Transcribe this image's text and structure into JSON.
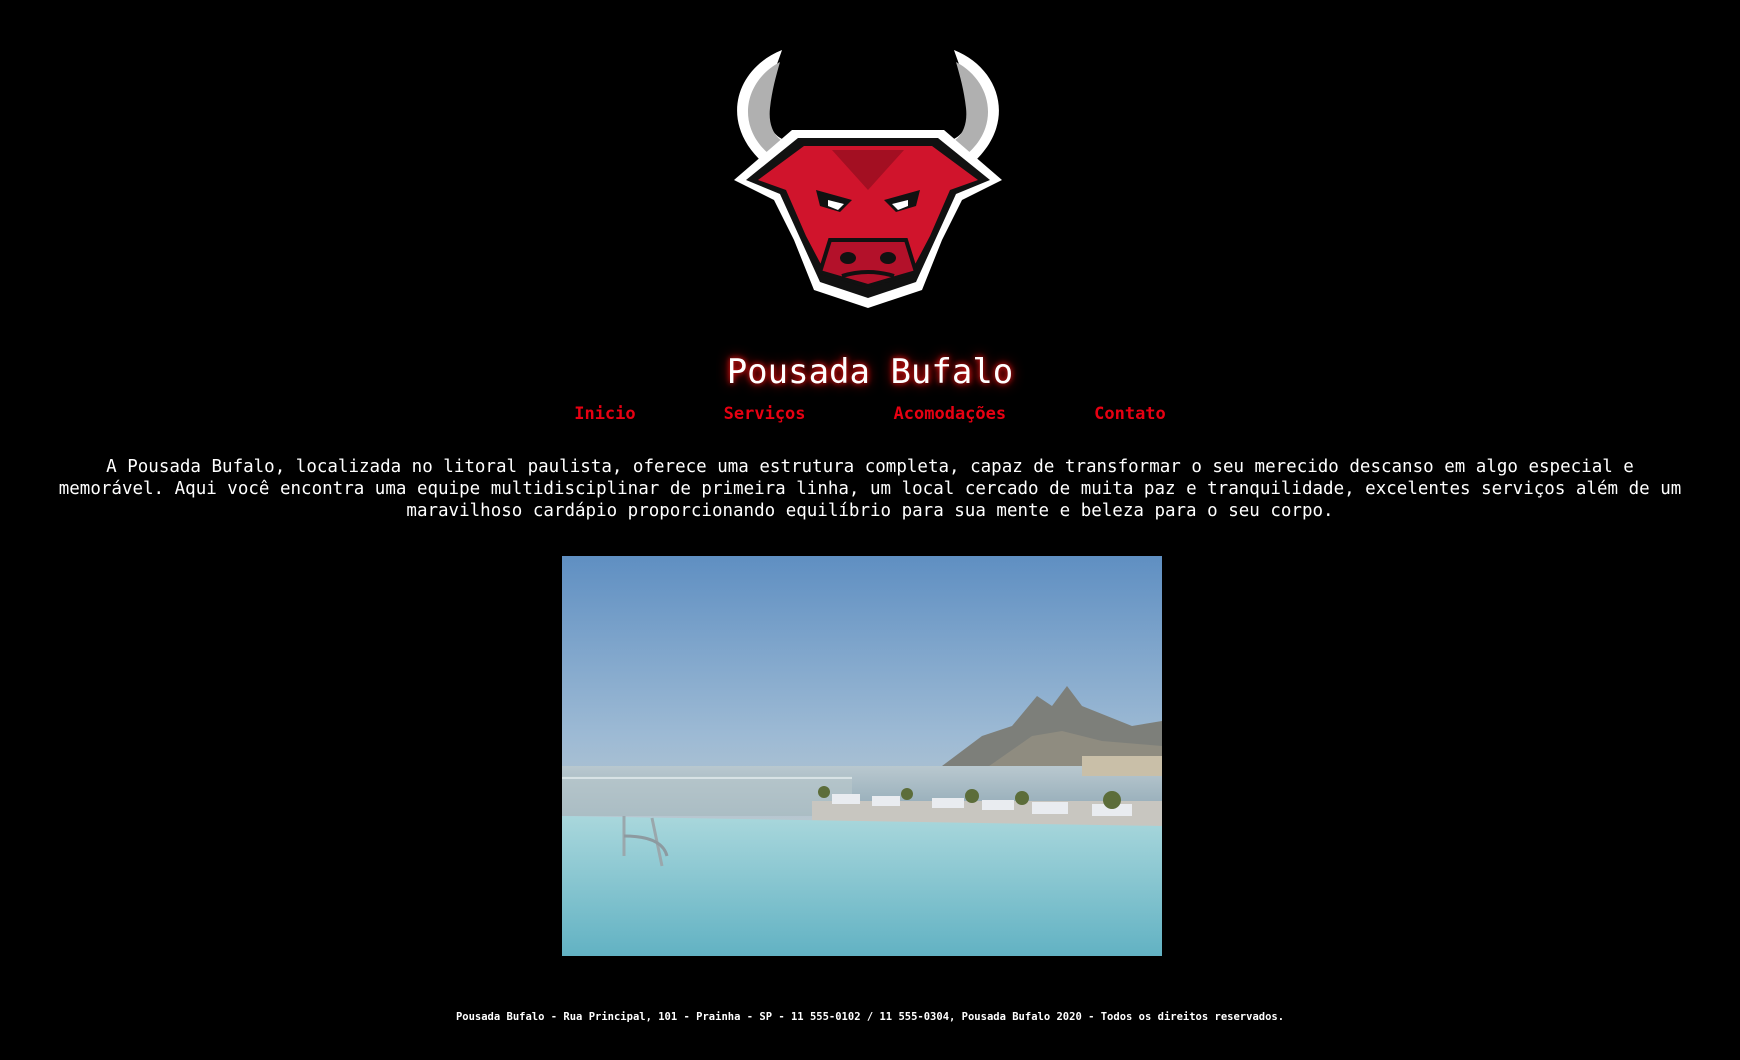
{
  "site": {
    "title": "Pousada Bufalo",
    "logo_icon": "bull-head-logo",
    "accent_color": "#e60012"
  },
  "nav": {
    "items": [
      {
        "label": "Inicio"
      },
      {
        "label": "Serviços"
      },
      {
        "label": "Acomodações"
      },
      {
        "label": "Contato"
      }
    ]
  },
  "intro": {
    "text": "A Pousada Bufalo, localizada no litoral paulista, oferece uma estrutura completa, capaz de transformar o seu merecido descanso em algo especial e memorável. Aqui você encontra uma equipe multidisciplinar de primeira linha, um local cercado de muita paz e tranquilidade, excelentes serviços além de um maravilhoso cardápio proporcionando equilíbrio para sua mente e beleza para o seu corpo."
  },
  "hero": {
    "icon": "infinity-pool-ocean-view-photo"
  },
  "footer": {
    "text": "Pousada Bufalo - Rua Principal, 101 - Prainha - SP - 11 555-0102 / 11 555-0304, Pousada Bufalo 2020 - Todos os direitos reservados."
  }
}
